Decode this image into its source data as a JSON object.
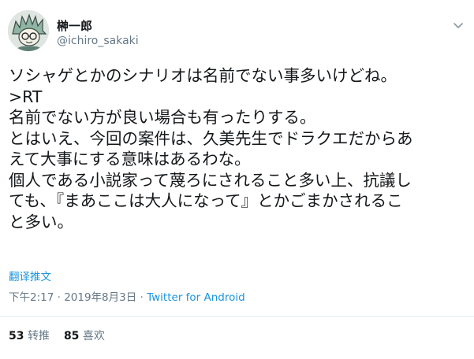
{
  "user": {
    "display_name": "榊一郎",
    "handle": "@ichiro_sakaki",
    "avatar_icon": "avatar-illustration-icon"
  },
  "header": {
    "menu_icon": "chevron-down-icon"
  },
  "tweet": {
    "text": "ソシャゲとかのシナリオは名前でない事多いけどね。\n>RT\n名前でない方が良い場合も有ったりする。\nとはいえ、今回の案件は、久美先生でドラクエだからあ\nえて大事にする意味はあるわな。\n個人である小説家って蔑ろにされること多い上、抗議し\nても、『まあここは大人になって』とかごまかされるこ\nと多い。",
    "translate_label": "翻译推文",
    "time": "下午2:17",
    "separator": " · ",
    "date": "2019年8月3日",
    "source": "Twitter for Android"
  },
  "stats": {
    "retweets_count": "53",
    "retweets_label": "转推",
    "likes_count": "85",
    "likes_label": "喜欢"
  },
  "colors": {
    "link": "#1b95e0",
    "secondary_text": "#657786",
    "primary_text": "#14171a",
    "divider": "#e1e8ed"
  }
}
